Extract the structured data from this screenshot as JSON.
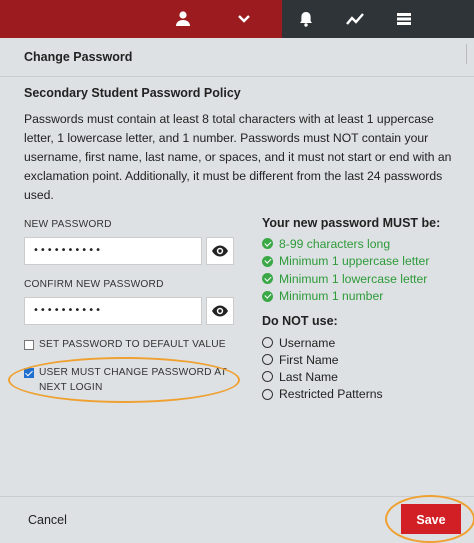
{
  "topbar": {
    "icons": [
      "user-icon",
      "chevron-down-icon",
      "bell-icon",
      "trend-chart-icon",
      "list-icon"
    ]
  },
  "modal": {
    "title": "Change Password"
  },
  "policy": {
    "title": "Secondary Student Password Policy",
    "text": "Passwords must contain at least 8 total characters with at least 1 uppercase letter, 1 lowercase letter, and 1 number. Passwords must NOT contain your username, first name, last name, or spaces, and it must not start or end with an exclamation point. Additionally, it must be different from the last 24 passwords used."
  },
  "form": {
    "new_password_label": "NEW PASSWORD",
    "new_password_value": "••••••••••",
    "confirm_password_label": "CONFIRM NEW PASSWORD",
    "confirm_password_value": "••••••••••",
    "default_value_label": "SET PASSWORD TO DEFAULT VALUE",
    "default_value_checked": false,
    "must_change_label": "USER MUST CHANGE PASSWORD AT NEXT LOGIN",
    "must_change_checked": true
  },
  "requirements": {
    "title": "Your new password MUST be:",
    "items": [
      "8-99 characters long",
      "Minimum 1 uppercase letter",
      "Minimum 1 lowercase letter",
      "Minimum 1 number"
    ],
    "color": "#2e9a3a"
  },
  "forbidden": {
    "title": "Do NOT use:",
    "items": [
      "Username",
      "First Name",
      "Last Name",
      "Restricted Patterns"
    ]
  },
  "footer": {
    "cancel_label": "Cancel",
    "save_label": "Save"
  },
  "colors": {
    "brand_red": "#9b1b1e",
    "save_red": "#d21f25",
    "highlight_orange": "#f0a030",
    "checkbox_blue": "#1f6fd1"
  }
}
